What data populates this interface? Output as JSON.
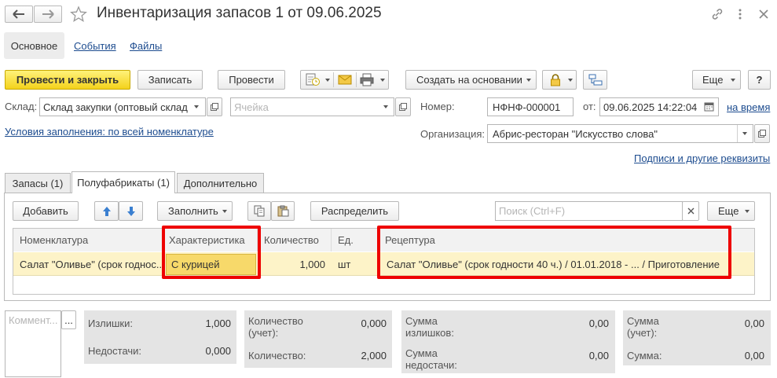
{
  "header": {
    "title": "Инвентаризация запасов 1 от 09.06.2025"
  },
  "nav_tabs": [
    {
      "label": "Основное"
    },
    {
      "label": "События"
    },
    {
      "label": "Файлы"
    }
  ],
  "toolbar": {
    "post_close": "Провести и закрыть",
    "save": "Записать",
    "post": "Провести",
    "create_based": "Создать на основании",
    "more": "Еще",
    "help": "?"
  },
  "form": {
    "warehouse_label": "Склад:",
    "warehouse_value": "Склад закупки (оптовый склад",
    "cell_placeholder": "Ячейка",
    "number_label": "Номер:",
    "number_value": "НФНФ-000001",
    "date_label": "от:",
    "date_value": "09.06.2025 14:22:04",
    "on_time_link": "на время",
    "fill_conditions_link": "Условия заполнения: по всей номенклатуре",
    "org_label": "Организация:",
    "org_value": "Абрис-ресторан \"Искусство слова\"",
    "signatures_link": "Подписи и другие реквизиты"
  },
  "tabs": [
    {
      "label": "Запасы (1)"
    },
    {
      "label": "Полуфабрикаты (1)"
    },
    {
      "label": "Дополнительно"
    }
  ],
  "table_toolbar": {
    "add": "Добавить",
    "fill": "Заполнить",
    "distribute": "Распределить",
    "search_placeholder": "Поиск (Ctrl+F)",
    "more": "Еще"
  },
  "table": {
    "columns": [
      "Номенклатура",
      "Характеристика",
      "Количество",
      "Ед.",
      "Рецептура"
    ],
    "rows": [
      {
        "item": "Салат \"Оливье\" (срок годнос...",
        "characteristic": "С курицей",
        "quantity": "1,000",
        "unit": "шт",
        "recipe": "Салат \"Оливье\" (срок годности 40 ч.) / 01.01.2018 - ... / Приготовление"
      }
    ]
  },
  "footer": {
    "comment_placeholder": "Коммент...",
    "comment_btn": "...",
    "surplus_label": "Излишки:",
    "surplus_value": "1,000",
    "shortage_label": "Недостачи:",
    "shortage_value": "0,000",
    "qty_account_label": "Количество (учет):",
    "qty_account_value": "0,000",
    "qty_label": "Количество:",
    "qty_value": "2,000",
    "sum_surplus_label": "Сумма излишков:",
    "sum_surplus_value": "0,00",
    "sum_shortage_label": "Сумма недостачи:",
    "sum_shortage_value": "0,00",
    "sum_account_label": "Сумма (учет):",
    "sum_account_value": "0,00",
    "sum_label": "Сумма:",
    "sum_value": "0,00"
  },
  "colors": {
    "accent_yellow": "#f4d21c",
    "highlight_row": "#fdf3c8",
    "selected_cell": "#f7d96a",
    "link_blue": "#1d4c8f",
    "annotation_red": "#ee0000"
  }
}
